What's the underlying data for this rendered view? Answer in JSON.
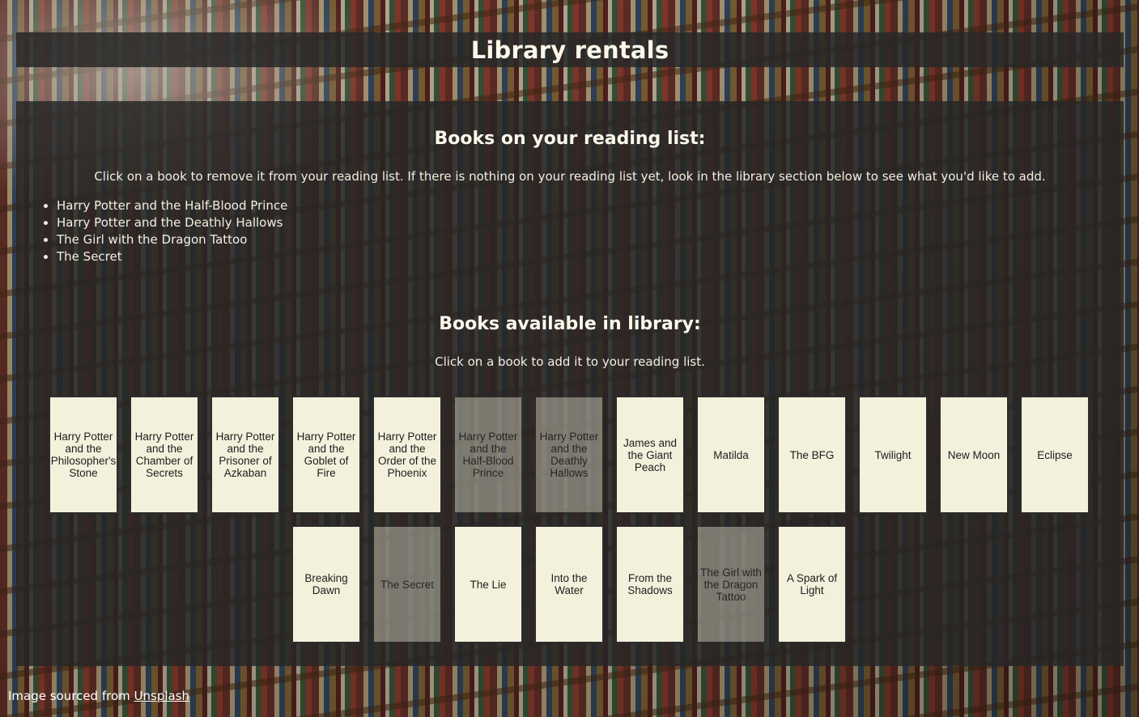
{
  "header": {
    "title": "Library rentals"
  },
  "reading_list": {
    "title": "Books on your reading list:",
    "instruction": "Click on a book to remove it from your reading list. If there is nothing on your reading list yet, look in the library section below to see what you'd like to add.",
    "items": [
      "Harry Potter and the Half-Blood Prince",
      "Harry Potter and the Deathly Hallows",
      "The Girl with the Dragon Tattoo",
      "The Secret"
    ]
  },
  "library": {
    "title": "Books available in library:",
    "instruction": "Click on a book to add it to your reading list.",
    "books": [
      {
        "title": "Harry Potter and the Philosopher's Stone",
        "on_list": false
      },
      {
        "title": "Harry Potter and the Chamber of Secrets",
        "on_list": false
      },
      {
        "title": "Harry Potter and the Prisoner of Azkaban",
        "on_list": false
      },
      {
        "title": "Harry Potter and the Goblet of Fire",
        "on_list": false
      },
      {
        "title": "Harry Potter and the Order of the Phoenix",
        "on_list": false
      },
      {
        "title": "Harry Potter and the Half-Blood Prince",
        "on_list": true
      },
      {
        "title": "Harry Potter and the Deathly Hallows",
        "on_list": true
      },
      {
        "title": "James and the Giant Peach",
        "on_list": false
      },
      {
        "title": "Matilda",
        "on_list": false
      },
      {
        "title": "The BFG",
        "on_list": false
      },
      {
        "title": "Twilight",
        "on_list": false
      },
      {
        "title": "New Moon",
        "on_list": false
      },
      {
        "title": "Eclipse",
        "on_list": false
      },
      {
        "title": "Breaking Dawn",
        "on_list": false
      },
      {
        "title": "The Secret",
        "on_list": true
      },
      {
        "title": "The Lie",
        "on_list": false
      },
      {
        "title": "Into the Water",
        "on_list": false
      },
      {
        "title": "From the Shadows",
        "on_list": false
      },
      {
        "title": "The Girl with the Dragon Tattoo",
        "on_list": true
      },
      {
        "title": "A Spark of Light",
        "on_list": false
      }
    ]
  },
  "footer": {
    "text": "Image sourced from ",
    "link_label": "Unsplash"
  },
  "colors": {
    "book_card": "#f3f1dc",
    "panel": "#262626"
  }
}
